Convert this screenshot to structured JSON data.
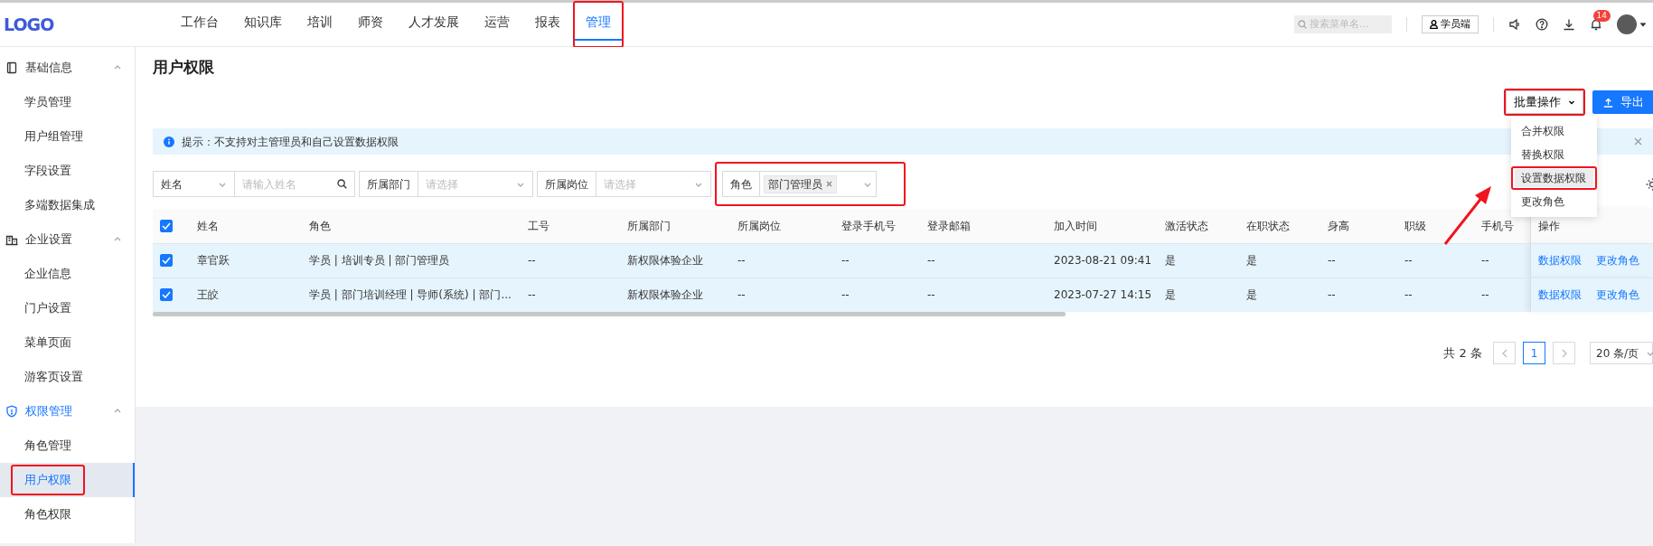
{
  "logo": "LOGO",
  "nav": [
    {
      "label": "工作台",
      "selected": false,
      "highlighted": false
    },
    {
      "label": "知识库",
      "selected": false,
      "highlighted": false
    },
    {
      "label": "培训",
      "selected": false,
      "highlighted": false
    },
    {
      "label": "师资",
      "selected": false,
      "highlighted": false
    },
    {
      "label": "人才发展",
      "selected": false,
      "highlighted": false
    },
    {
      "label": "运营",
      "selected": false,
      "highlighted": false
    },
    {
      "label": "报表",
      "selected": false,
      "highlighted": false
    },
    {
      "label": "管理",
      "selected": true,
      "highlighted": true
    }
  ],
  "search": {
    "placeholder": "搜索菜单名..."
  },
  "portal_button": "学员端",
  "notifications": {
    "badge": "14"
  },
  "sidebar": [
    {
      "label": "基础信息",
      "expanded": true,
      "children": [
        {
          "label": "学员管理",
          "selected": false,
          "highlighted": false
        },
        {
          "label": "用户组管理",
          "selected": false,
          "highlighted": false
        },
        {
          "label": "字段设置",
          "selected": false,
          "highlighted": false
        },
        {
          "label": "多端数据集成",
          "selected": false,
          "highlighted": false
        }
      ]
    },
    {
      "label": "企业设置",
      "expanded": true,
      "children": [
        {
          "label": "企业信息",
          "selected": false,
          "highlighted": false
        },
        {
          "label": "门户设置",
          "selected": false,
          "highlighted": false
        },
        {
          "label": "菜单页面",
          "selected": false,
          "highlighted": false
        },
        {
          "label": "游客页设置",
          "selected": false,
          "highlighted": false
        }
      ]
    },
    {
      "label": "权限管理",
      "expanded": true,
      "children": [
        {
          "label": "角色管理",
          "selected": false,
          "highlighted": false
        },
        {
          "label": "用户权限",
          "selected": true,
          "highlighted": true
        },
        {
          "label": "角色权限",
          "selected": false,
          "highlighted": false
        }
      ]
    }
  ],
  "page_title": "用户权限",
  "bulk_button": {
    "label": "批量操作",
    "highlighted": true
  },
  "export_button": "导出",
  "bulk_menu": [
    {
      "label": "合并权限",
      "hover": false,
      "highlighted": false
    },
    {
      "label": "替换权限",
      "hover": false,
      "highlighted": false
    },
    {
      "label": "设置数据权限",
      "hover": true,
      "highlighted": true
    },
    {
      "label": "更改角色",
      "hover": false,
      "highlighted": false
    }
  ],
  "alert": "提示：不支持对主管理员和自己设置数据权限",
  "filters": [
    {
      "kind": "select-input",
      "label": "姓名",
      "placeholder": "请输入姓名",
      "highlighted": false
    },
    {
      "kind": "select",
      "label": "所属部门",
      "placeholder": "请选择",
      "highlighted": false
    },
    {
      "kind": "select",
      "label": "所属岗位",
      "placeholder": "请选择",
      "highlighted": false
    },
    {
      "kind": "tags",
      "label": "角色",
      "tags": [
        "部门管理员"
      ],
      "highlighted": true
    }
  ],
  "table": {
    "all_checked": true,
    "columns": [
      "姓名",
      "角色",
      "工号",
      "所属部门",
      "所属岗位",
      "登录手机号",
      "登录邮箱",
      "加入时间",
      "激活状态",
      "在职状态",
      "身高",
      "职级",
      "手机号",
      "操作"
    ],
    "rows": [
      {
        "checked": true,
        "cells": [
          "章官跃",
          "学员 | 培训专员 | 部门管理员",
          "--",
          "新权限体验企业",
          "--",
          "--",
          "--",
          "2023-08-21 09:41",
          "是",
          "是",
          "--",
          "--",
          "--"
        ],
        "actions": [
          "数据权限",
          "更改角色"
        ]
      },
      {
        "checked": true,
        "cells": [
          "王皎",
          "学员 | 部门培训经理 | 导师(系统) | 部门...",
          "--",
          "新权限体验企业",
          "--",
          "--",
          "--",
          "2023-07-27 14:15",
          "是",
          "是",
          "--",
          "--",
          "--"
        ],
        "actions": [
          "数据权限",
          "更改角色"
        ]
      }
    ]
  },
  "pagination": {
    "total": "共 2 条",
    "pages": [
      {
        "label": "1",
        "selected": true
      }
    ],
    "page_size": "20 条/页"
  }
}
